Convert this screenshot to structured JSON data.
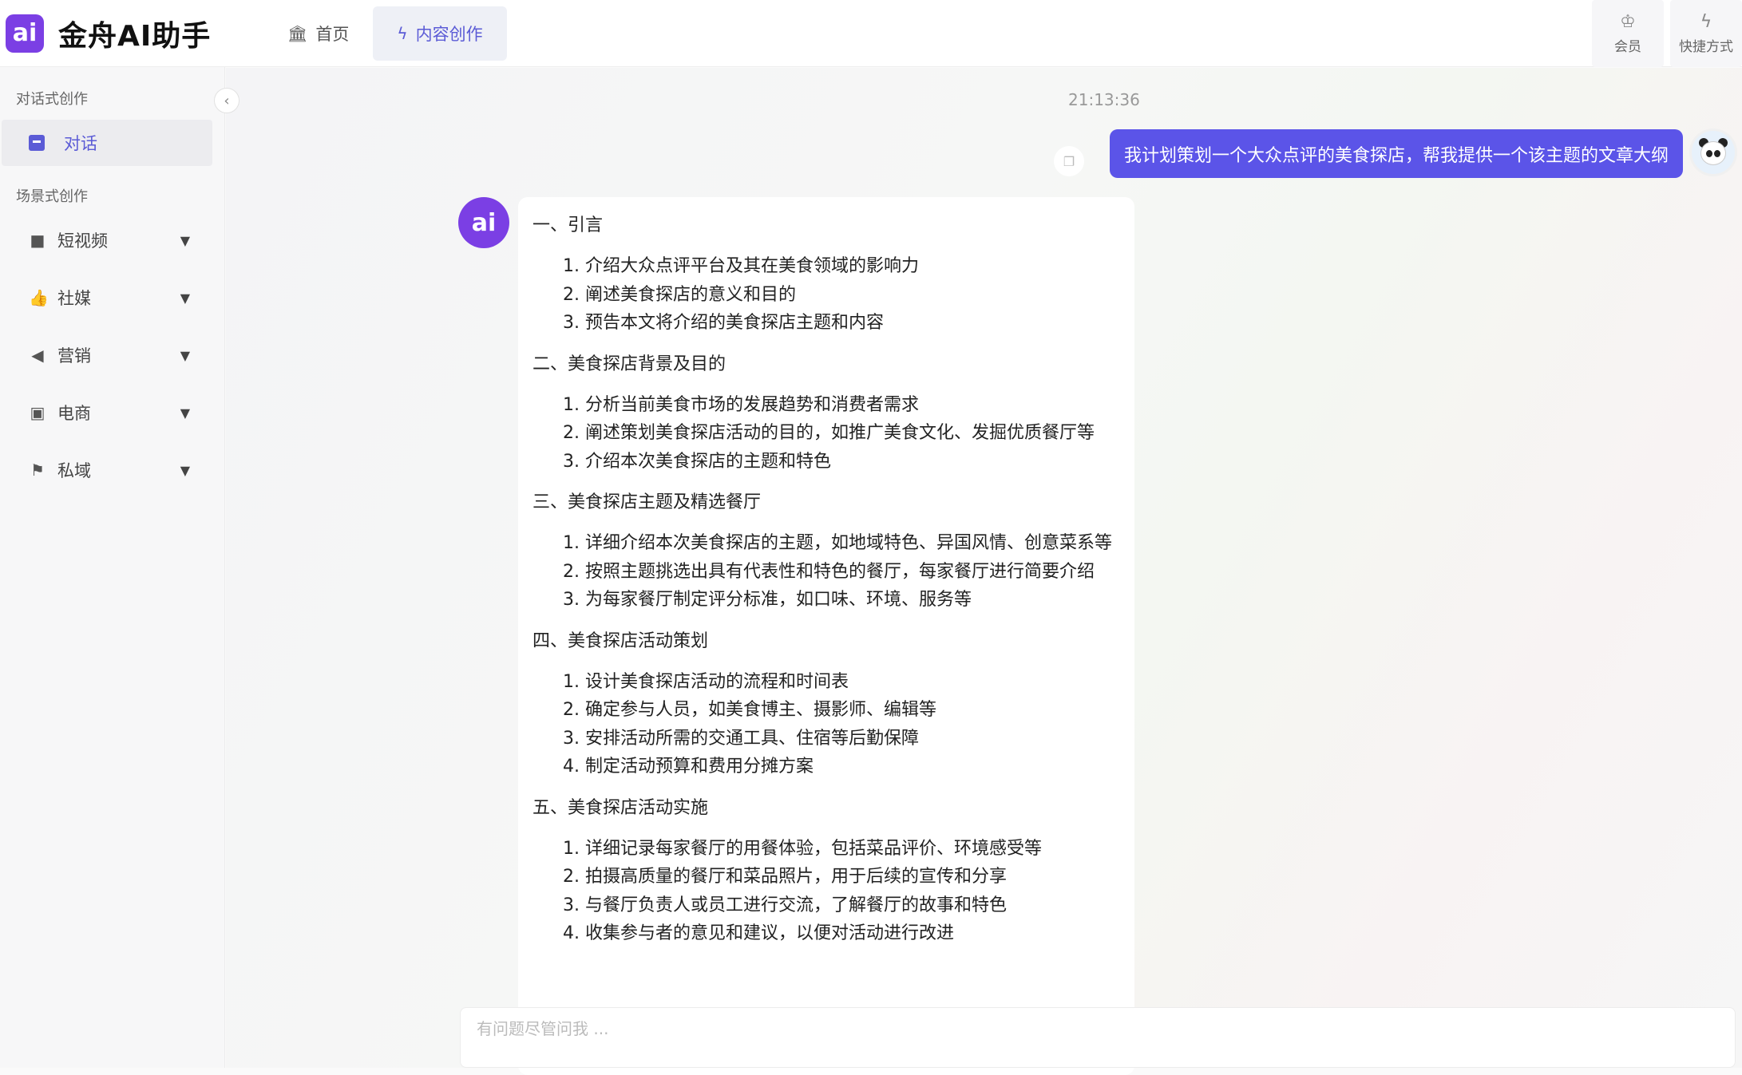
{
  "app": {
    "logo_text": "金舟AI助手",
    "logo_mark": "ai"
  },
  "nav": {
    "home": {
      "label": "首页",
      "icon": "bank-icon"
    },
    "content": {
      "label": "内容创作",
      "icon": "lightning-icon"
    }
  },
  "top_actions": [
    {
      "label": "会员",
      "icon": "crown-icon"
    },
    {
      "label": "快捷方式",
      "icon": "lightning-icon"
    }
  ],
  "sidebar": {
    "section_chat": "对话式创作",
    "chat_item": "对话",
    "section_scene": "场景式创作",
    "items": [
      {
        "label": "短视频",
        "icon": "video-icon"
      },
      {
        "label": "社媒",
        "icon": "thumbs-up-icon"
      },
      {
        "label": "营销",
        "icon": "megaphone-icon"
      },
      {
        "label": "电商",
        "icon": "shopping-bag-icon"
      },
      {
        "label": "私域",
        "icon": "flag-icon"
      }
    ]
  },
  "chat": {
    "timestamp": "21:13:36",
    "user_message": "我计划策划一个大众点评的美食探店，帮我提供一个该主题的文章大纲",
    "sections": [
      {
        "title": "一、引言",
        "items": [
          "1. 介绍大众点评平台及其在美食领域的影响力",
          "2. 阐述美食探店的意义和目的",
          "3. 预告本文将介绍的美食探店主题和内容"
        ]
      },
      {
        "title": "二、美食探店背景及目的",
        "items": [
          "1. 分析当前美食市场的发展趋势和消费者需求",
          "2. 阐述策划美食探店活动的目的，如推广美食文化、发掘优质餐厅等",
          "3. 介绍本次美食探店的主题和特色"
        ]
      },
      {
        "title": "三、美食探店主题及精选餐厅",
        "items": [
          "1. 详细介绍本次美食探店的主题，如地域特色、异国风情、创意菜系等",
          "2. 按照主题挑选出具有代表性和特色的餐厅，每家餐厅进行简要介绍",
          "3. 为每家餐厅制定评分标准，如口味、环境、服务等"
        ]
      },
      {
        "title": "四、美食探店活动策划",
        "items": [
          "1. 设计美食探店活动的流程和时间表",
          "2. 确定参与人员，如美食博主、摄影师、编辑等",
          "3. 安排活动所需的交通工具、住宿等后勤保障",
          "4. 制定活动预算和费用分摊方案"
        ]
      },
      {
        "title": "五、美食探店活动实施",
        "items": [
          "1. 详细记录每家餐厅的用餐体验，包括菜品评价、环境感受等",
          "2. 拍摄高质量的餐厅和菜品照片，用于后续的宣传和分享",
          "3. 与餐厅负责人或员工进行交流，了解餐厅的故事和特色",
          "4. 收集参与者的意见和建议，以便对活动进行改进"
        ]
      }
    ]
  },
  "input": {
    "placeholder": "有问题尽管问我 ..."
  },
  "colors": {
    "brand": "#7b3fe4",
    "accent": "#5b54e8"
  }
}
